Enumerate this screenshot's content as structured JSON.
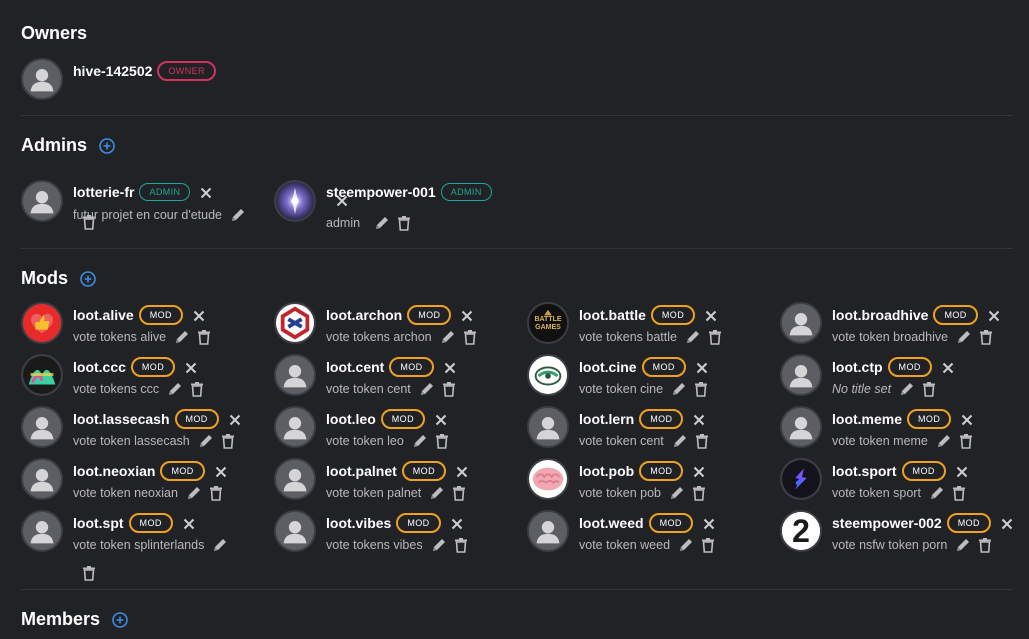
{
  "owners": {
    "title": "Owners",
    "items": [
      {
        "name": "hive-142502",
        "badge": "OWNER"
      }
    ]
  },
  "admins": {
    "title": "Admins",
    "items": [
      {
        "name": "lotterie-fr",
        "badge": "ADMIN",
        "subtitle": "futur projet en cour d'etude"
      },
      {
        "name": "steempower-001",
        "badge": "ADMIN",
        "subtitle": "admin"
      }
    ]
  },
  "mods": {
    "title": "Mods",
    "items": [
      {
        "name": "loot.alive",
        "badge": "MOD",
        "subtitle": "vote tokens alive",
        "avatar": "alive"
      },
      {
        "name": "loot.archon",
        "badge": "MOD",
        "subtitle": "vote tokens archon",
        "avatar": "archon"
      },
      {
        "name": "loot.battle",
        "badge": "MOD",
        "subtitle": "vote tokens battle",
        "avatar": "battle"
      },
      {
        "name": "loot.broadhive",
        "badge": "MOD",
        "subtitle": "vote token broadhive",
        "avatar": "default"
      },
      {
        "name": "loot.ccc",
        "badge": "MOD",
        "subtitle": "vote tokens ccc",
        "avatar": "ccc"
      },
      {
        "name": "loot.cent",
        "badge": "MOD",
        "subtitle": "vote token cent",
        "avatar": "default"
      },
      {
        "name": "loot.cine",
        "badge": "MOD",
        "subtitle": "vote token cine",
        "avatar": "cine"
      },
      {
        "name": "loot.ctp",
        "badge": "MOD",
        "subtitle": "No title set",
        "avatar": "default"
      },
      {
        "name": "loot.lassecash",
        "badge": "MOD",
        "subtitle": "vote token lassecash",
        "avatar": "default"
      },
      {
        "name": "loot.leo",
        "badge": "MOD",
        "subtitle": "vote token leo",
        "avatar": "default"
      },
      {
        "name": "loot.lern",
        "badge": "MOD",
        "subtitle": "vote token cent",
        "avatar": "default"
      },
      {
        "name": "loot.meme",
        "badge": "MOD",
        "subtitle": "vote token meme",
        "avatar": "default"
      },
      {
        "name": "loot.neoxian",
        "badge": "MOD",
        "subtitle": "vote token neoxian",
        "avatar": "default"
      },
      {
        "name": "loot.palnet",
        "badge": "MOD",
        "subtitle": "vote token palnet",
        "avatar": "default"
      },
      {
        "name": "loot.pob",
        "badge": "MOD",
        "subtitle": "vote token pob",
        "avatar": "pob"
      },
      {
        "name": "loot.sport",
        "badge": "MOD",
        "subtitle": "vote token sport",
        "avatar": "sport"
      },
      {
        "name": "loot.spt",
        "badge": "MOD",
        "subtitle": "vote token splinterlands",
        "avatar": "default"
      },
      {
        "name": "loot.vibes",
        "badge": "MOD",
        "subtitle": "vote tokens vibes",
        "avatar": "default"
      },
      {
        "name": "loot.weed",
        "badge": "MOD",
        "subtitle": "vote token weed",
        "avatar": "default"
      },
      {
        "name": "steempower-002",
        "badge": "MOD",
        "subtitle": "vote nsfw token porn",
        "avatar": "two"
      }
    ]
  },
  "members": {
    "title": "Members"
  },
  "avatar_text": {
    "battle_line1": "BATTLE",
    "battle_line2": "GAMES",
    "two": "2"
  },
  "colors": {
    "background": "#212225",
    "owner_badge": "#d0345e",
    "admin_badge": "#1ea69b",
    "mod_badge": "#f0a11f",
    "add_icon": "#3d8ee6"
  }
}
